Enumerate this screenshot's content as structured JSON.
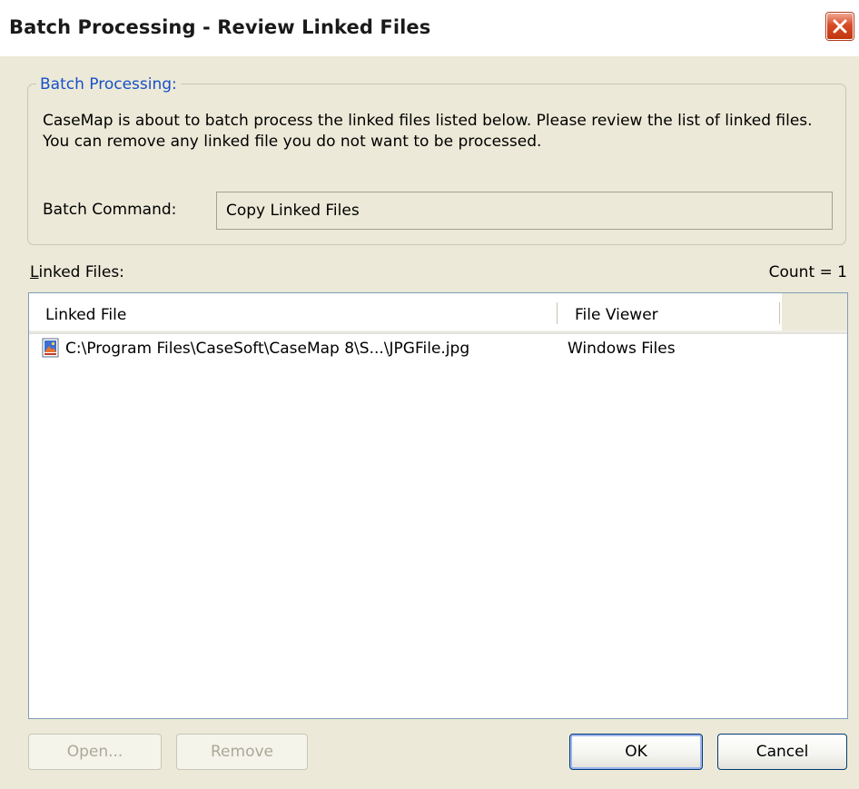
{
  "window": {
    "title": "Batch Processing - Review Linked Files"
  },
  "group": {
    "legend": "Batch Processing:",
    "description": "CaseMap is about to batch process the linked files listed below.  Please review the list of linked files.  You can remove any linked file you do not want to be processed.",
    "batch_command_label": "Batch Command:",
    "batch_command_value": "Copy Linked Files"
  },
  "linked_files": {
    "label_mnemonic": "L",
    "label_rest": "inked Files:",
    "count_text": "Count = 1",
    "columns": [
      "Linked File",
      "File Viewer"
    ],
    "rows": [
      {
        "icon": "jpg-file-icon",
        "path": "C:\\Program Files\\CaseSoft\\CaseMap 8\\S...\\JPGFile.jpg",
        "viewer": "Windows Files"
      }
    ]
  },
  "buttons": {
    "open": "Open...",
    "remove": "Remove",
    "ok": "OK",
    "cancel": "Cancel"
  },
  "colors": {
    "legend_blue": "#1750c8",
    "close_red": "#d64b27",
    "dialog_bg": "#ece9d8"
  },
  "icons": {
    "close": "close-icon",
    "file": "jpg-file-icon"
  }
}
